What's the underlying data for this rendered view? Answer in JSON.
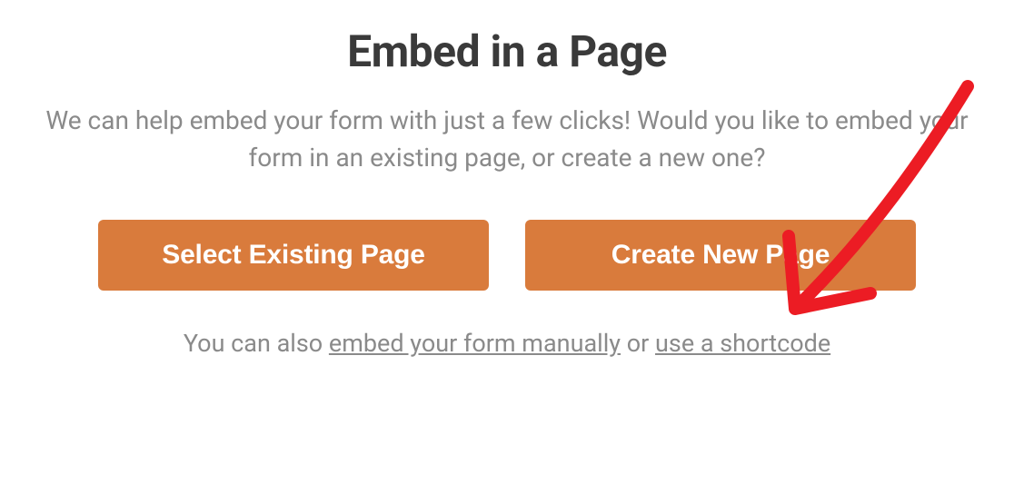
{
  "title": "Embed in a Page",
  "subtitle": "We can help embed your form with just a few clicks! Would you like to embed your form in an existing page, or create a new one?",
  "buttons": {
    "select_existing": "Select Existing Page",
    "create_new": "Create New Page"
  },
  "footer": {
    "prefix": "You can also ",
    "link_manual": "embed your form manually",
    "middle": " or ",
    "link_shortcode": "use a shortcode"
  },
  "annotation": {
    "arrow_color": "#ec1c24",
    "target": "create-new-page-button"
  }
}
